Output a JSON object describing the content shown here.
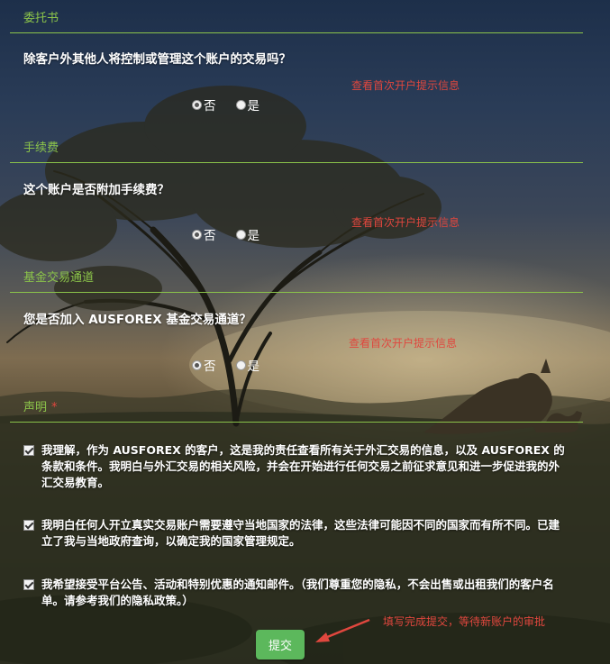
{
  "sections": {
    "trust": {
      "title": "委托书",
      "question": "除客户外其他人将控制或管理这个账户的交易吗？",
      "hint": "查看首次开户提示信息",
      "options": [
        "否",
        "是"
      ],
      "selected": "否"
    },
    "fee": {
      "title": "手续费",
      "question": "这个账户是否附加手续费？",
      "hint": "查看首次开户提示信息",
      "options": [
        "否",
        "是"
      ],
      "selected": "否"
    },
    "fund": {
      "title": "基金交易通道",
      "question": "您是否加入 AUSFOREX 基金交易通道？",
      "hint": "查看首次开户提示信息",
      "options": [
        "否",
        "是"
      ],
      "selected": "否"
    },
    "statement": {
      "title": "声明",
      "required_mark": "*",
      "items": [
        {
          "text": "我理解，作为 AUSFOREX 的客户，这是我的责任查看所有关于外汇交易的信息，以及 AUSFOREX 的条款和条件。我明白与外汇交易的相关风险，并会在开始进行任何交易之前征求意见和进一步促进我的外汇交易教育。",
          "checked": true
        },
        {
          "text": "我明白任何人开立真实交易账户需要遵守当地国家的法律，这些法律可能因不同的国家而有所不同。已建立了我与当地政府查询，以确定我的国家管理规定。",
          "checked": true
        },
        {
          "text": "我希望接受平台公告、活动和特别优惠的通知邮件。（我们尊重您的隐私，不会出售或出租我们的客户名单。请参考我们的隐私政策。）",
          "checked": true
        }
      ]
    }
  },
  "submit_label": "提交",
  "annotation": "填写完成提交，等待新账户的审批",
  "colors": {
    "accent_green": "#8bc34a",
    "button_green": "#5cb85c",
    "hint_red": "#e0473e"
  }
}
